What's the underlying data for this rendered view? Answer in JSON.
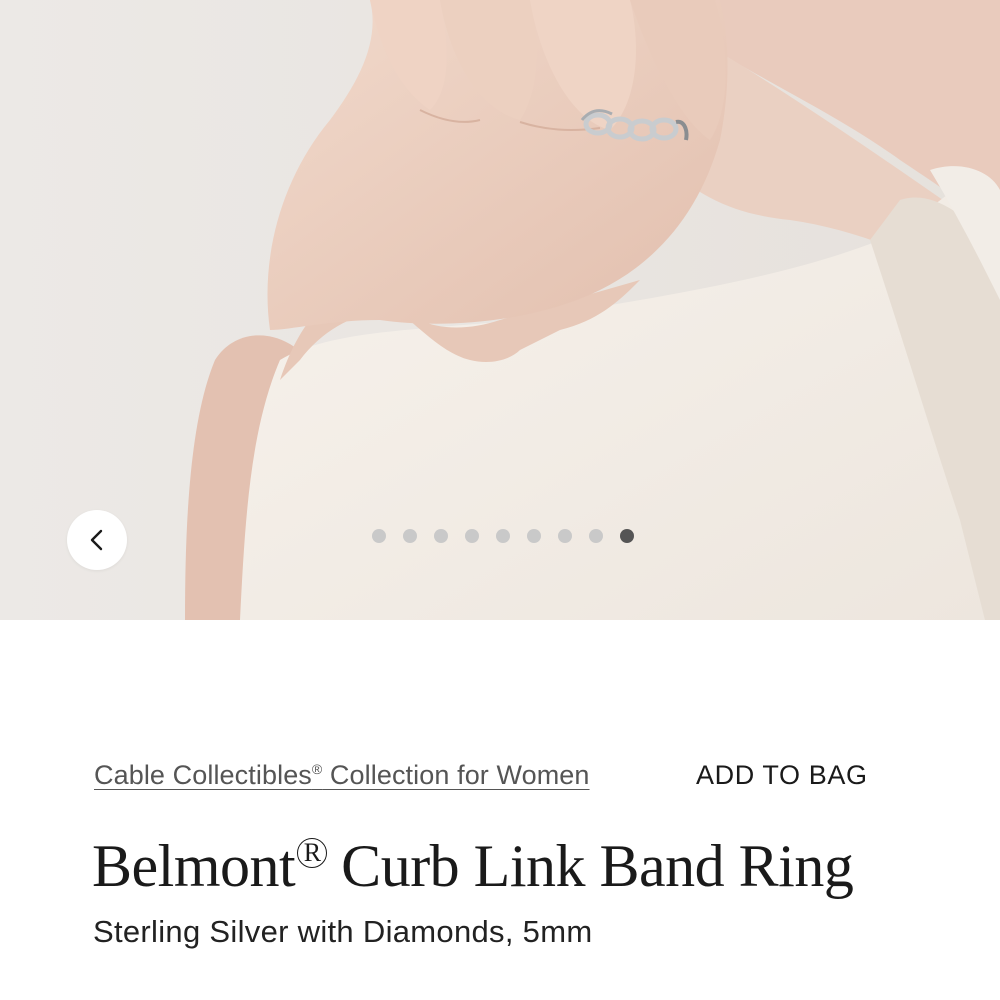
{
  "gallery": {
    "prev_label": "Previous image",
    "slide_count": 9,
    "active_index": 8
  },
  "product": {
    "collection_name": "Cable Collectibles",
    "collection_mark": "®",
    "collection_suffix": " Collection for Women",
    "add_to_bag": "ADD TO BAG",
    "title_brand": "Belmont",
    "title_mark": "R",
    "title_rest": "Curb Link Band Ring",
    "subtitle": "Sterling Silver with Diamonds, 5mm"
  },
  "colors": {
    "background": "#ffffff",
    "dot_inactive": "#c9c9c9",
    "dot_active": "#555555",
    "link_text": "#555555"
  }
}
